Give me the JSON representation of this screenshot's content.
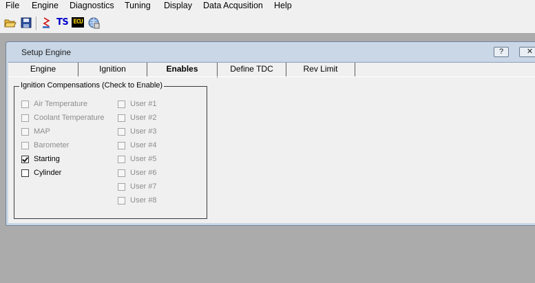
{
  "menu": {
    "items": [
      "File",
      "Engine",
      "Diagnostics",
      "Tuning",
      "Display",
      "Data Acqusition",
      "Help"
    ]
  },
  "toolbar": {
    "ts_label": "TS",
    "ecu_label": "ECU"
  },
  "window": {
    "title": "Setup Engine",
    "help_button": "?",
    "close_button": "✕"
  },
  "tabs": [
    {
      "label": "Engine",
      "active": false
    },
    {
      "label": "Ignition",
      "active": false
    },
    {
      "label": "Enables",
      "active": true
    },
    {
      "label": "Define TDC",
      "active": false
    },
    {
      "label": "Rev Limit",
      "active": false
    }
  ],
  "group": {
    "title": "Ignition Compensations (Check to Enable)",
    "left_column": [
      {
        "label": "Air Temperature",
        "checked": false,
        "enabled": false
      },
      {
        "label": "Coolant Temperature",
        "checked": false,
        "enabled": false
      },
      {
        "label": "MAP",
        "checked": false,
        "enabled": false
      },
      {
        "label": "Barometer",
        "checked": false,
        "enabled": false
      },
      {
        "label": "Starting",
        "checked": true,
        "enabled": true
      },
      {
        "label": "Cylinder",
        "checked": false,
        "enabled": true
      }
    ],
    "right_column": [
      {
        "label": "User #1",
        "checked": false,
        "enabled": false
      },
      {
        "label": "User #2",
        "checked": false,
        "enabled": false
      },
      {
        "label": "User #3",
        "checked": false,
        "enabled": false
      },
      {
        "label": "User #4",
        "checked": false,
        "enabled": false
      },
      {
        "label": "User #5",
        "checked": false,
        "enabled": false
      },
      {
        "label": "User #6",
        "checked": false,
        "enabled": false
      },
      {
        "label": "User #7",
        "checked": false,
        "enabled": false
      },
      {
        "label": "User #8",
        "checked": false,
        "enabled": false
      }
    ]
  },
  "colors": {
    "desktop": "#ababab",
    "window_frame": "#c9d7e6",
    "client": "#f0f0f0",
    "ts_text": "#0000cc",
    "ecu_text": "#ffd800"
  }
}
